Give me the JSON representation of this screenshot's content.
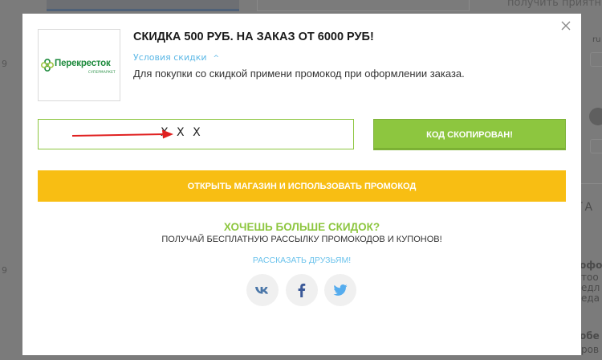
{
  "background": {
    "top_right_text": "получить приятн",
    "left_numbers": [
      "9",
      "9"
    ],
    "right_texts": [
      "ru",
      "ГА",
      "офо",
      "тоо",
      "едл",
      "еда",
      "обе",
      "ров"
    ]
  },
  "modal": {
    "title": "СКИДКА 500 РУБ. НА ЗАКАЗ ОТ 6000 РУБ!",
    "conditions_link": "Условия скидки",
    "description": "Для покупки со скидкой примени промокод при оформлении заказа.",
    "logo": {
      "brand": "Перекресток",
      "subtitle": "СУПЕРМАРКЕТ",
      "icon": "clover-logo-icon",
      "color": "#1d8a3c"
    },
    "promo_code": {
      "value": "X X X"
    },
    "copy_button": "КОД СКОПИРОВАН!",
    "shop_button": "ОТКРЫТЬ МАГАЗИН И ИСПОЛЬЗОВАТЬ ПРОМОКОД",
    "more_title": "ХОЧЕШЬ БОЛЬШЕ СКИДОК?",
    "more_subtitle": "ПОЛУЧАЙ БЕСПЛАТНУЮ РАССЫЛКУ ПРОМОКОДОВ И КУПОНОВ!",
    "share_link": "РАССКАЗАТЬ ДРУЗЬЯМ!",
    "social": [
      {
        "name": "vk",
        "icon": "vk-icon",
        "color": "#4a76a8"
      },
      {
        "name": "facebook",
        "icon": "facebook-icon",
        "color": "#3b5998"
      },
      {
        "name": "twitter",
        "icon": "twitter-icon",
        "color": "#55acee"
      }
    ],
    "colors": {
      "accent_green": "#8dc63f",
      "accent_yellow": "#f8be13",
      "link_blue": "#5cb8e6",
      "arrow_red": "#e02020"
    }
  }
}
